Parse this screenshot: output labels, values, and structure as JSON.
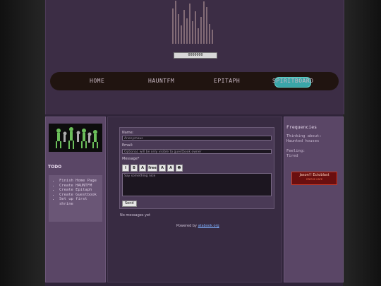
{
  "header": {
    "counter_text": "0000000"
  },
  "nav": {
    "items": [
      {
        "label": "HOME"
      },
      {
        "label": "HAUNTFM"
      },
      {
        "label": "EPITAPH"
      },
      {
        "label": "SPIRITBOARD"
      }
    ]
  },
  "sidebar_left": {
    "todo_title": "TODO",
    "todo_items": [
      "Finish Home Page",
      "Create HAUNTFM",
      "Create Epitaph",
      "Create Guestbook",
      "Set up first shrine"
    ]
  },
  "guestbook": {
    "name_label": "Name:",
    "name_value": "Anonymous",
    "email_label": "Email:",
    "email_placeholder": "Optional, will be only visible to guestbook owner",
    "message_label": "Message*",
    "message_placeholder": "Say something nice",
    "send_label": "Send",
    "empty_text": "No messages yet",
    "powered_prefix": "Powered by ",
    "powered_link": "atabook.org",
    "toolbar": [
      "I",
      "B",
      "A",
      "free",
      "A",
      "A",
      "☻"
    ]
  },
  "sidebar_right": {
    "title": "Frequencies",
    "thinking_label": "Thinking about:",
    "thinking_value": "Haunted houses",
    "feeling_label": "Feeling:",
    "feeling_value": "Tired",
    "badge_text": "Jason!! Ectoblast",
    "badge_sub": "STATUS CAFE"
  },
  "colors": {
    "header_bg": "#3c2d45",
    "nav_bg": "#201410",
    "accent_teal": "#3aa6a8",
    "sidebar_bg": "#5a4666"
  }
}
